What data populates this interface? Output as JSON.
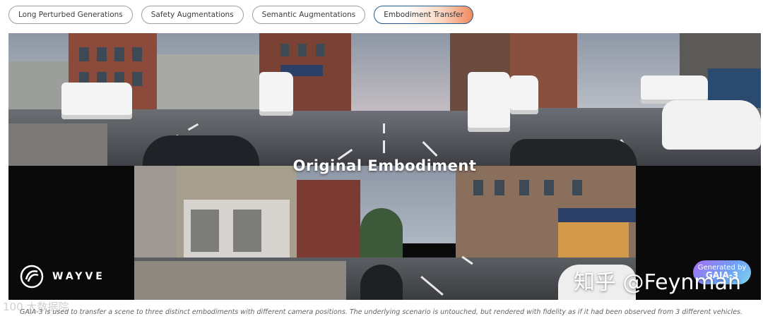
{
  "tabs": [
    {
      "label": "Long Perturbed Generations",
      "active": false
    },
    {
      "label": "Safety Augmentations",
      "active": false
    },
    {
      "label": "Semantic Augmentations",
      "active": false
    },
    {
      "label": "Embodiment Transfer",
      "active": true
    }
  ],
  "video": {
    "overlay_title": "Original Embodiment",
    "brand": "WAYVE",
    "badge_line1": "Generated by",
    "badge_line2": "GAIA-3",
    "watermark": "知乎 @Feynman"
  },
  "caption": "GAIA-3 is used to transfer a scene to three distinct embodiments with different camera positions. The underlying scenario is untouched, but rendered with fidelity as if it had been observed from 3 different vehicles.",
  "corner_watermark": "100 大数据院",
  "colors": {
    "accent_border": "#1f5b8c",
    "accent_gradient_end": "#f08a5d",
    "badge_start": "#a56cf5",
    "badge_end": "#7dd6ee"
  }
}
